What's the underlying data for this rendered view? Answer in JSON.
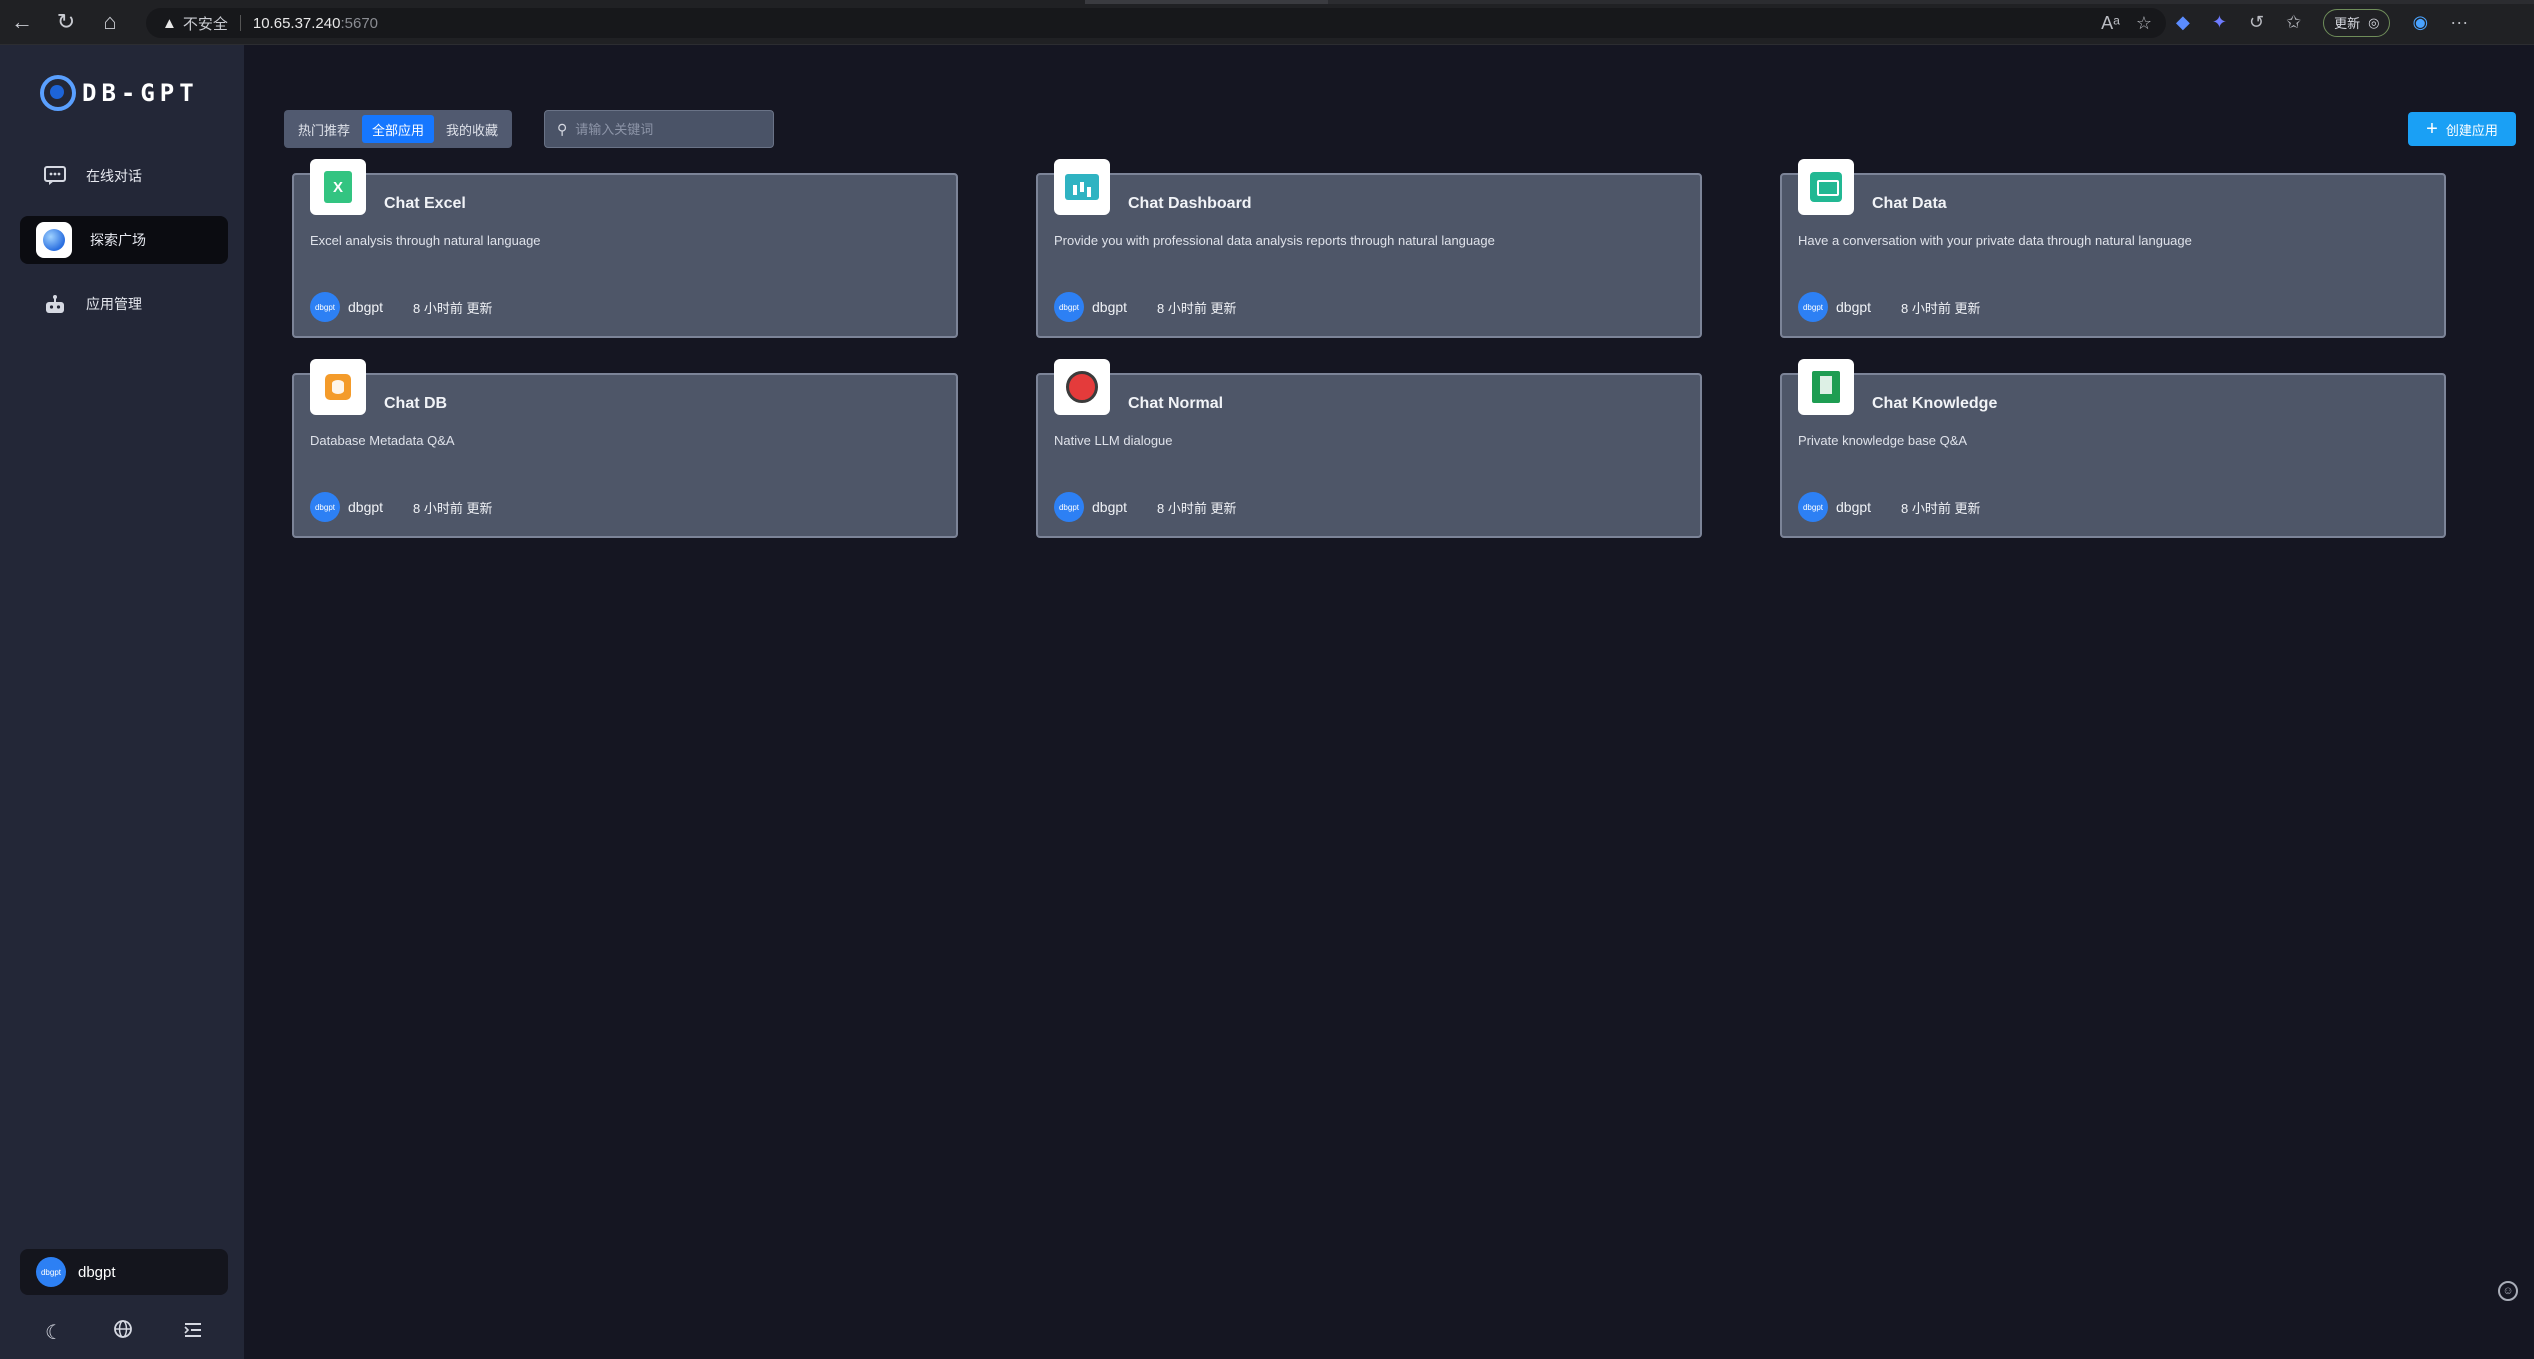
{
  "browser": {
    "security_label": "不安全",
    "url_host": "10.65.37.240",
    "url_port": ":5670",
    "update_label": "更新"
  },
  "sidebar": {
    "logo_text": "DB-GPT",
    "items": [
      {
        "label": "在线对话",
        "icon": "chat-bubble-icon"
      },
      {
        "label": "探索广场",
        "icon": "globe-icon",
        "active": true
      },
      {
        "label": "应用管理",
        "icon": "robot-icon"
      }
    ],
    "user": {
      "avatar_text": "dbgpt",
      "name": "dbgpt"
    },
    "footer_icons": [
      "moon-icon",
      "language-icon",
      "collapse-menu-icon"
    ]
  },
  "toolbar": {
    "tabs": [
      {
        "label": "热门推荐",
        "active": false
      },
      {
        "label": "全部应用",
        "active": true
      },
      {
        "label": "我的收藏",
        "active": false
      }
    ],
    "search_placeholder": "请输入关键词",
    "create_label": "创建应用"
  },
  "apps": [
    {
      "title": "Chat Excel",
      "desc": "Excel analysis through natural language",
      "icon": "excel-icon",
      "author_avatar": "dbgpt",
      "author": "dbgpt",
      "time": "8 小时前 更新"
    },
    {
      "title": "Chat Dashboard",
      "desc": "Provide you with professional data analysis reports through natural language",
      "icon": "dashboard-icon",
      "author_avatar": "dbgpt",
      "author": "dbgpt",
      "time": "8 小时前 更新"
    },
    {
      "title": "Chat Data",
      "desc": "Have a conversation with your private data through natural language",
      "icon": "data-chart-icon",
      "author_avatar": "dbgpt",
      "author": "dbgpt",
      "time": "8 小时前 更新"
    },
    {
      "title": "Chat DB",
      "desc": "Database Metadata Q&A",
      "icon": "database-icon",
      "author_avatar": "dbgpt",
      "author": "dbgpt",
      "time": "8 小时前 更新"
    },
    {
      "title": "Chat Normal",
      "desc": "Native LLM dialogue",
      "icon": "headset-icon",
      "author_avatar": "dbgpt",
      "author": "dbgpt",
      "time": "8 小时前 更新"
    },
    {
      "title": "Chat Knowledge",
      "desc": "Private knowledge base Q&A",
      "icon": "knowledge-book-icon",
      "author_avatar": "dbgpt",
      "author": "dbgpt",
      "time": "8 小时前 更新"
    }
  ],
  "colors": {
    "accent": "#1677ff",
    "create_button": "#1aa0f5",
    "card_bg": "#4e5668",
    "sidebar_bg": "#232737",
    "page_bg": "#151622"
  }
}
